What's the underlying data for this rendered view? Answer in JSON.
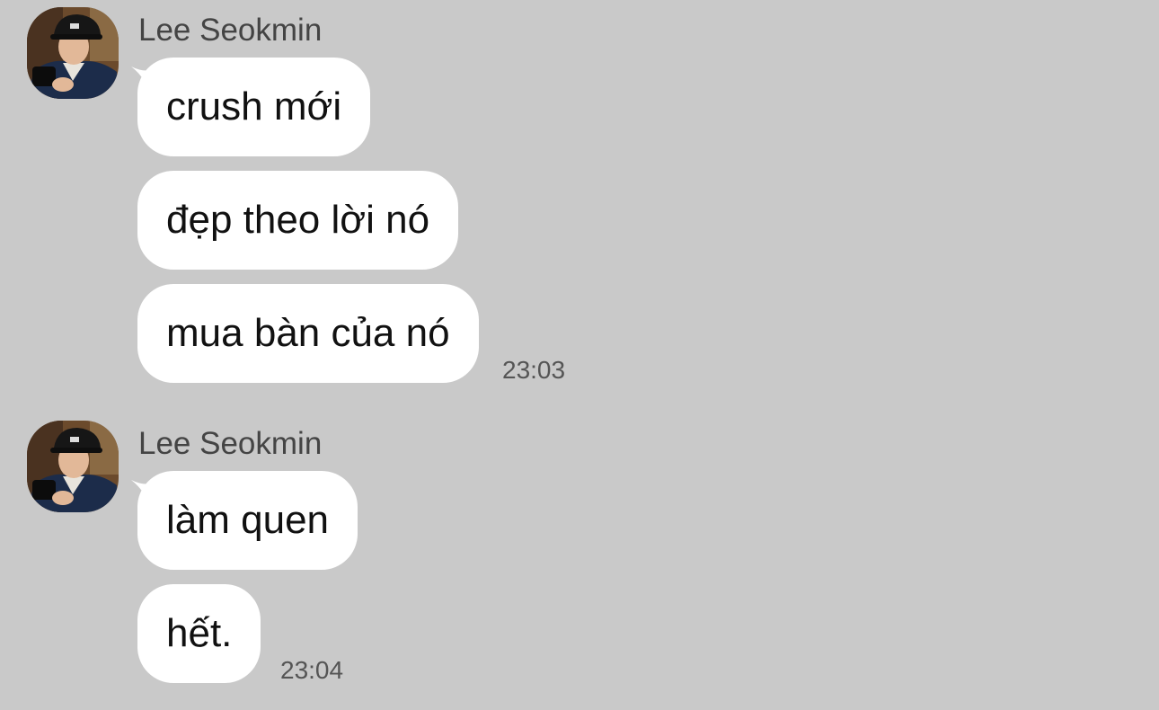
{
  "groups": [
    {
      "sender": "Lee Seokmin",
      "messages": [
        "crush mới",
        "đẹp theo lời nó",
        "mua bàn của nó"
      ],
      "time": "23:03"
    },
    {
      "sender": "Lee Seokmin",
      "messages": [
        "làm quen",
        "hết."
      ],
      "time": "23:04"
    }
  ],
  "colors": {
    "background": "#c9c9c9",
    "bubble": "#ffffff",
    "sender_text": "#444444",
    "time_text": "#555555"
  },
  "icons": {
    "avatar": "profile-photo"
  }
}
